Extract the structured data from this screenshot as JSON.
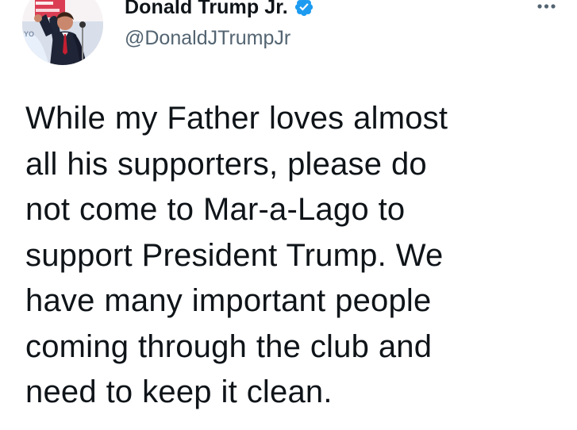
{
  "tweet": {
    "author": {
      "display_name": "Donald Trump Jr.",
      "handle": "@DonaldJTrumpJr",
      "verified_icon": "verified-badge-icon",
      "avatar_icon": "profile-avatar"
    },
    "text_lines": [
      "While my Father loves almost",
      "all his supporters, please do",
      "not come to Mar-a-Lago to",
      "support President Trump. We",
      "have many important people",
      "coming through the club and",
      "need to keep it clean."
    ],
    "more_icon": "more-options-icon"
  },
  "colors": {
    "text": "#0f1419",
    "secondary_text": "#536471",
    "verified_blue": "#1d9bf0",
    "background": "#ffffff"
  }
}
